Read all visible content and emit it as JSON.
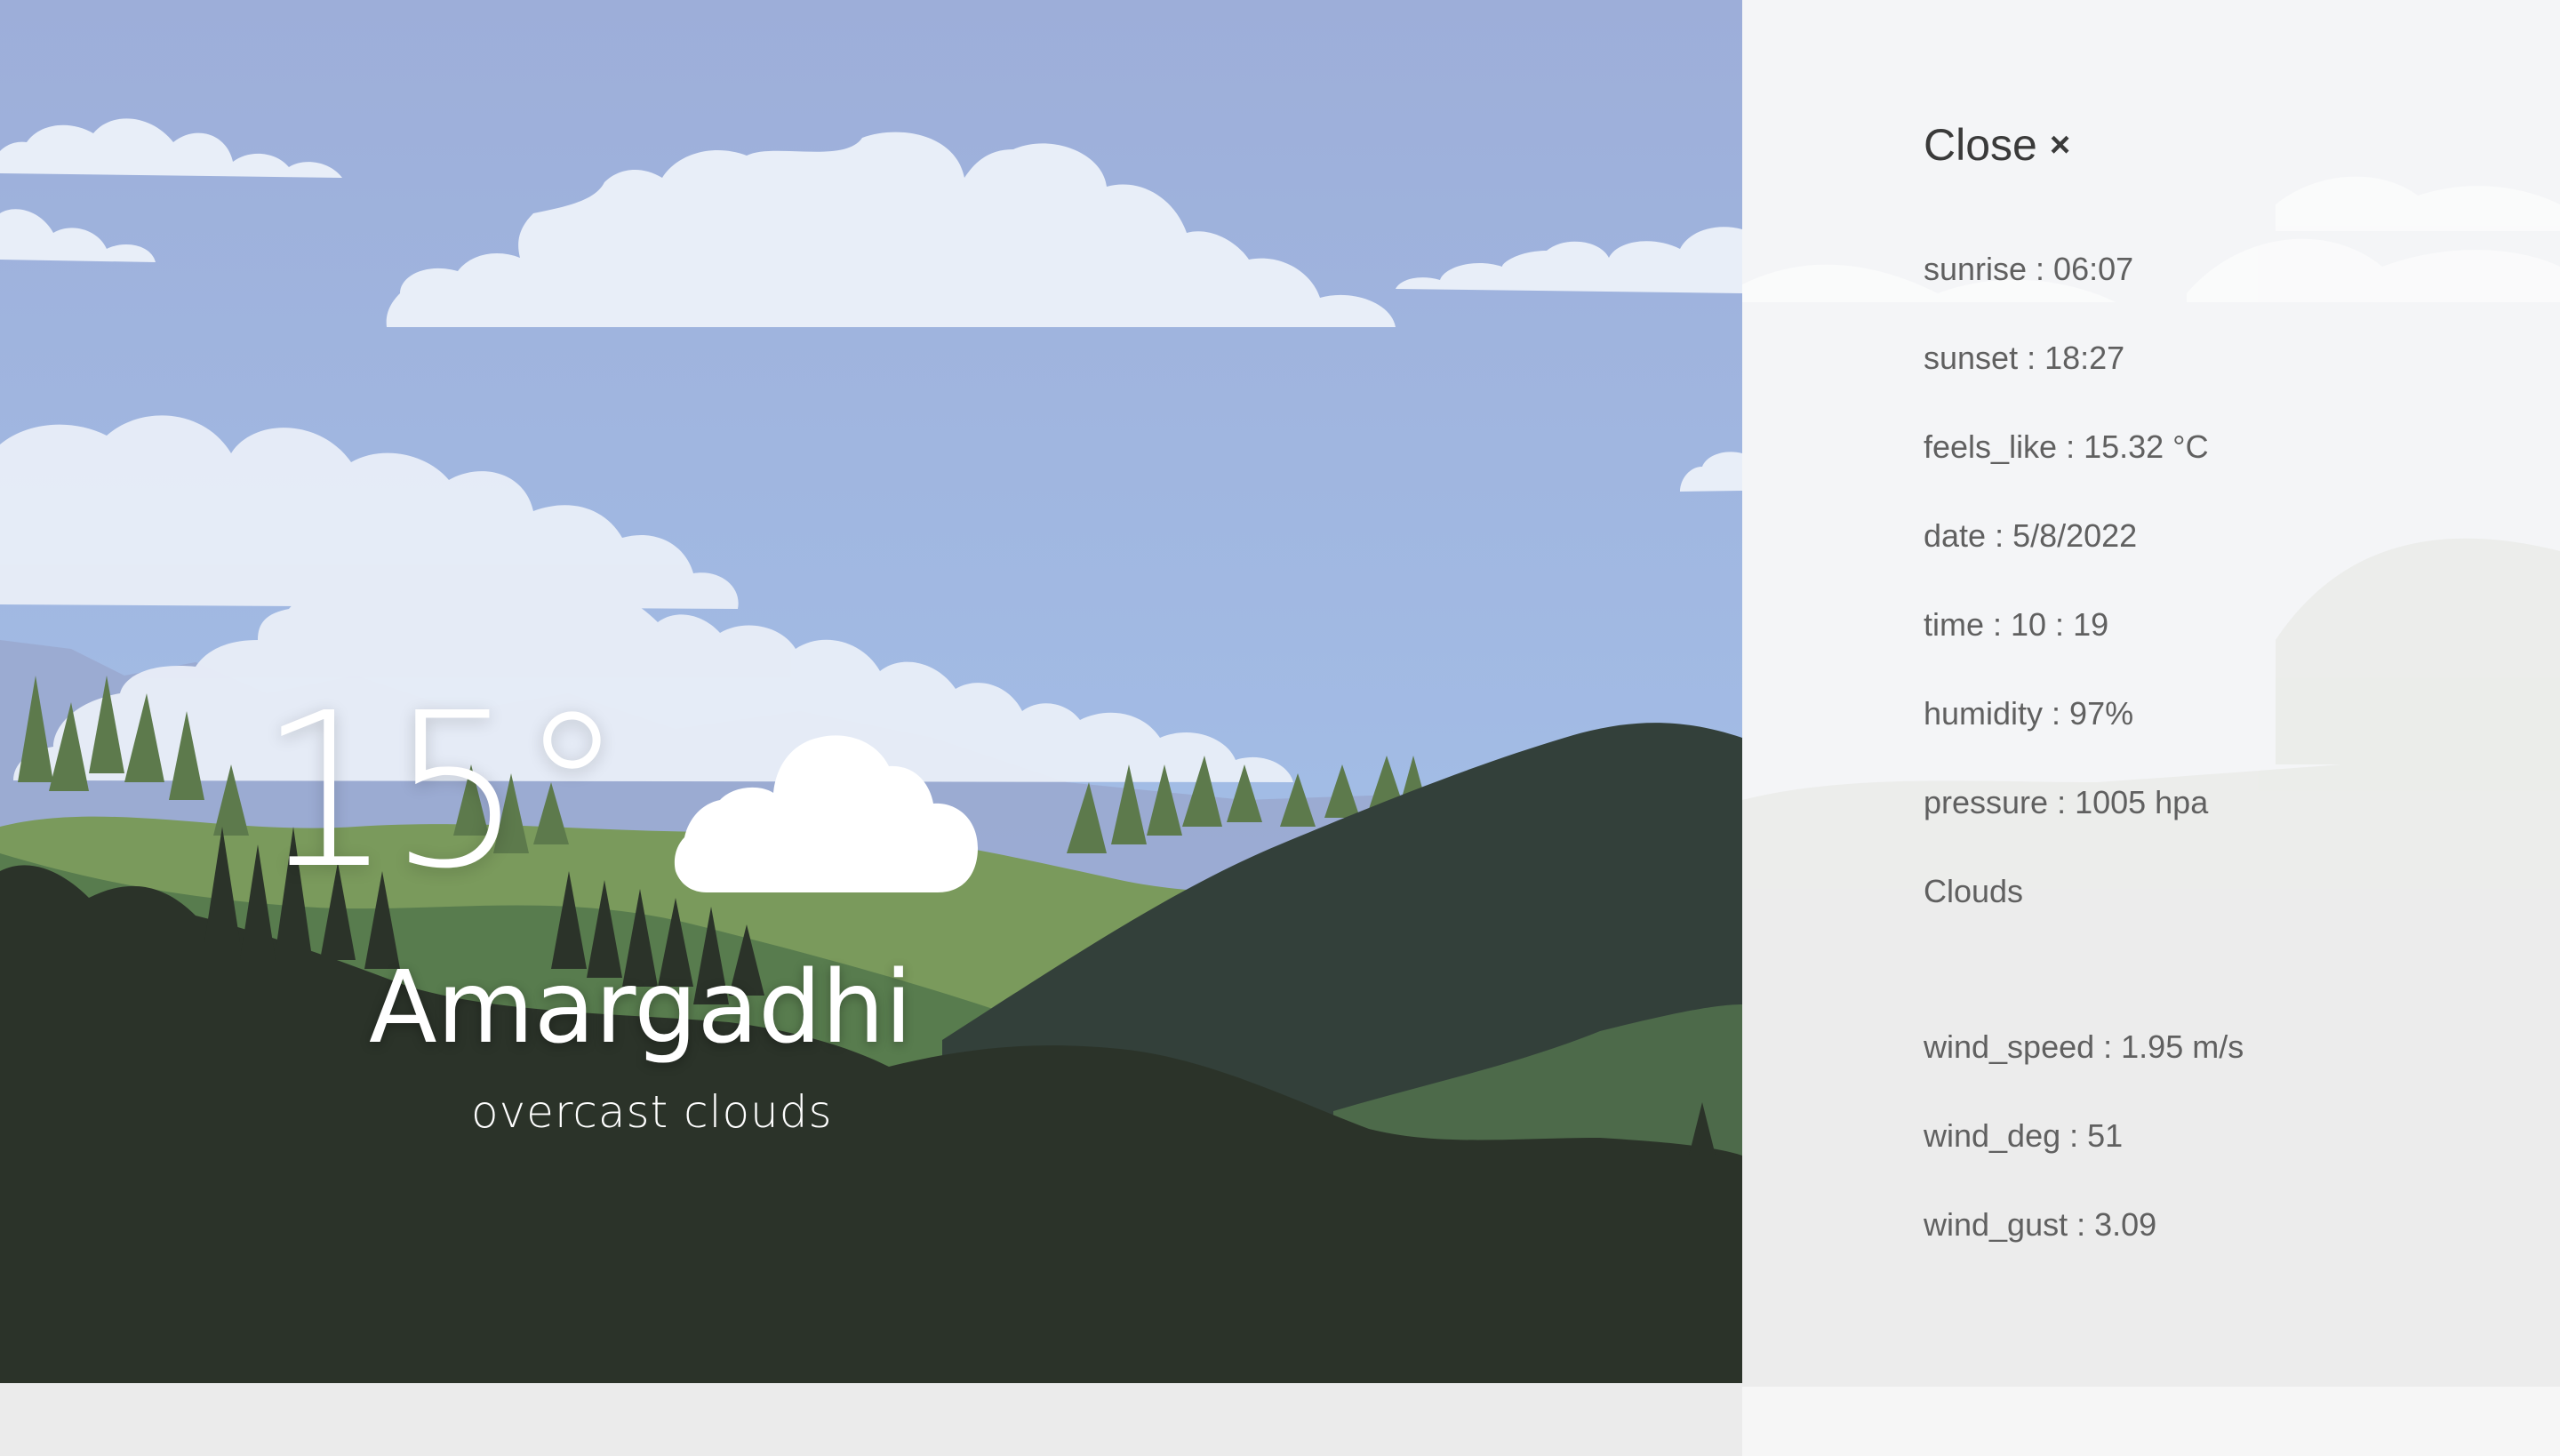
{
  "weather": {
    "temperature": "15°",
    "city": "Amargadhi",
    "description": "overcast clouds",
    "icon": "cloud-icon"
  },
  "details_panel": {
    "close_label": "Close",
    "close_icon": "×",
    "items": [
      "sunrise : 06:07",
      "sunset : 18:27",
      "feels_like : 15.32 °C",
      "date : 5/8/2022",
      "time : 10 : 19",
      "humidity : 97%",
      "pressure : 1005 hpa",
      "Clouds",
      "wind_speed : 1.95 m/s",
      "wind_deg : 51",
      "wind_gust : 3.09"
    ]
  },
  "colors": {
    "sky_top": "#9daed9",
    "sky_bottom": "#a4c4ec",
    "hill_light": "#7a9a5c",
    "hill_mid": "#587c4e",
    "hill_dark": "#2b3329",
    "cloud": "#e8eef8",
    "panel_bg": "#f3f4f6"
  }
}
